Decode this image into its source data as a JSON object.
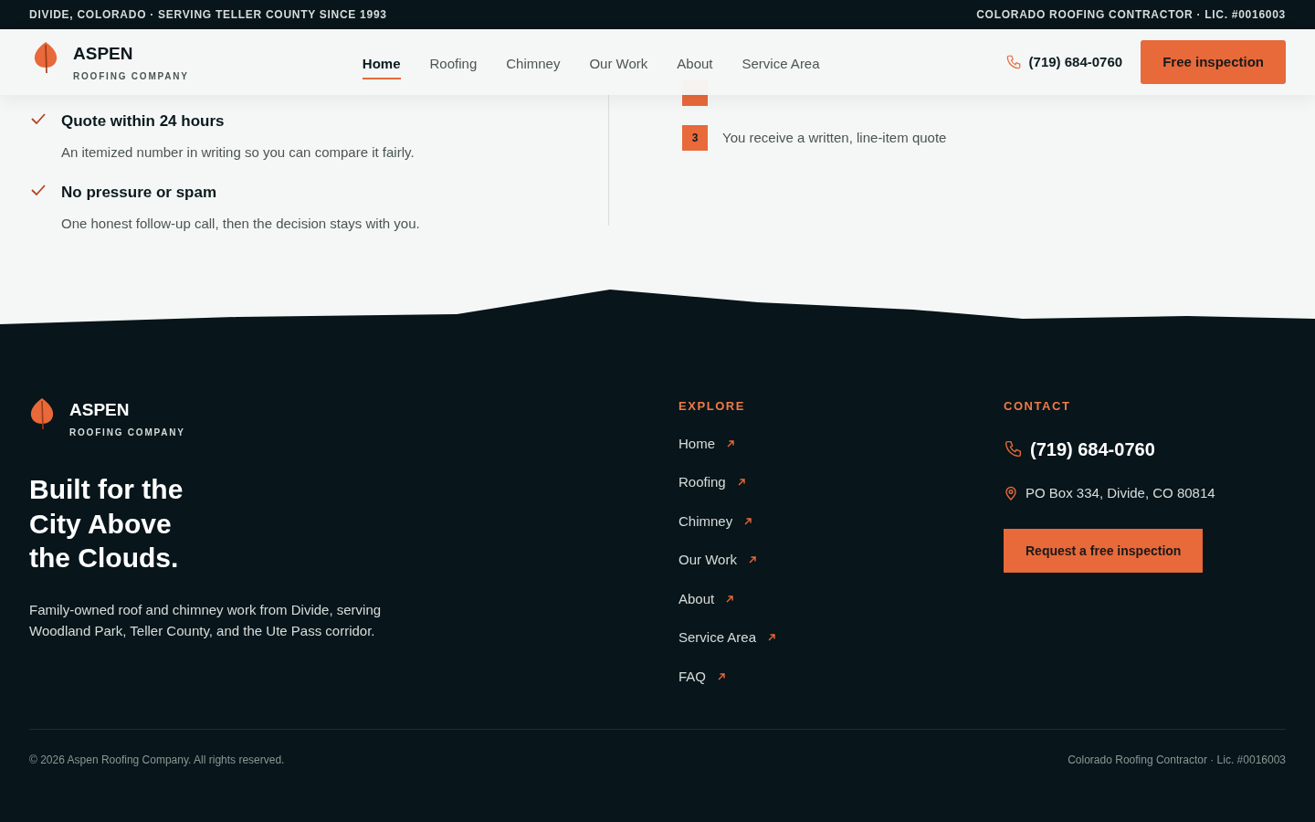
{
  "top_bar": {
    "left": "DIVIDE, COLORADO · SERVING TELLER COUNTY SINCE 1993",
    "right": "COLORADO ROOFING CONTRACTOR · LIC. #0016003"
  },
  "header": {
    "brand": {
      "name": "ASPEN",
      "tagline": "ROOFING COMPANY"
    },
    "nav": [
      {
        "label": "Home",
        "selected": true
      },
      {
        "label": "Roofing",
        "selected": false
      },
      {
        "label": "Chimney",
        "selected": false
      },
      {
        "label": "Our Work",
        "selected": false
      },
      {
        "label": "About",
        "selected": false
      },
      {
        "label": "Service Area",
        "selected": false
      }
    ],
    "phone": "(719) 684-0760",
    "cta": "Free inspection"
  },
  "benefits": [
    {
      "title": "Quote within 24 hours",
      "text": "An itemized number in writing so you can compare it fairly."
    },
    {
      "title": "No pressure or spam",
      "text": "One honest follow-up call, then the decision stays with you."
    }
  ],
  "steps": [
    {
      "number": "3",
      "text": "You receive a written, line-item quote"
    }
  ],
  "footer": {
    "brand": {
      "name": "ASPEN",
      "tagline": "ROOFING COMPANY"
    },
    "headline_lines": [
      "Built for the",
      "City Above",
      "the Clouds."
    ],
    "description": "Family-owned roof and chimney work from Divide, serving Woodland Park, Teller County, and the Ute Pass corridor.",
    "explore": {
      "heading": "EXPLORE",
      "links": [
        "Home",
        "Roofing",
        "Chimney",
        "Our Work",
        "About",
        "Service Area",
        "FAQ"
      ]
    },
    "contact": {
      "heading": "CONTACT",
      "phone": "(719) 684-0760",
      "address": "PO Box 334, Divide, CO 80814",
      "cta": "Request a free inspection"
    },
    "copyright": "© 2026 Aspen Roofing Company. All rights reserved.",
    "license": "Colorado Roofing Contractor · Lic. #0016003"
  }
}
